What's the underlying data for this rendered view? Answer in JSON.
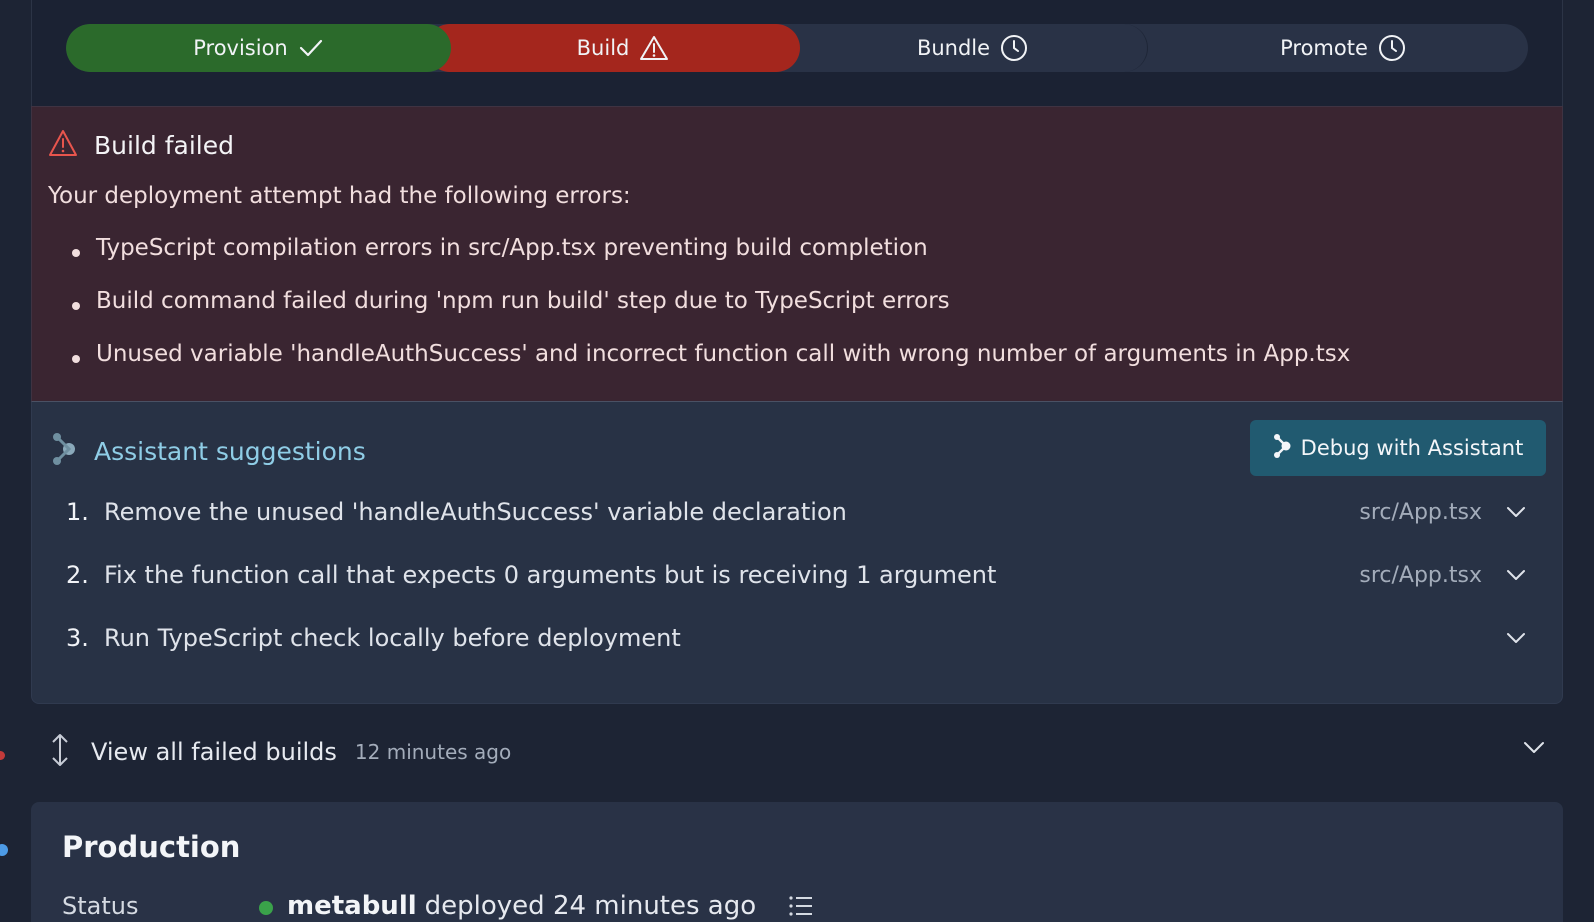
{
  "stepper": {
    "steps": [
      {
        "label": "Provision",
        "status": "success",
        "icon": "check-icon",
        "color": "#2b6a2b"
      },
      {
        "label": "Build",
        "status": "failed",
        "icon": "warning-icon",
        "color": "#a4261d"
      },
      {
        "label": "Bundle",
        "status": "pending",
        "icon": "clock-icon"
      },
      {
        "label": "Promote",
        "status": "pending",
        "icon": "clock-icon"
      }
    ]
  },
  "error": {
    "title": "Build failed",
    "intro": "Your deployment attempt had the following errors:",
    "items": [
      "TypeScript compilation errors in src/App.tsx preventing build completion",
      "Build command failed during 'npm run build' step due to TypeScript errors",
      "Unused variable 'handleAuthSuccess' and incorrect function call with wrong number of arguments in App.tsx"
    ]
  },
  "assistant": {
    "title": "Assistant suggestions",
    "debug_label": "Debug with Assistant",
    "suggestions": [
      {
        "num": "1.",
        "text": "Remove the unused 'handleAuthSuccess' variable declaration",
        "file": "src/App.tsx"
      },
      {
        "num": "2.",
        "text": "Fix the function call that expects 0 arguments but is receiving 1 argument",
        "file": "src/App.tsx"
      },
      {
        "num": "3.",
        "text": "Run TypeScript check locally before deployment",
        "file": ""
      }
    ]
  },
  "failed_builds": {
    "label": "View all failed builds",
    "time": "12 minutes ago"
  },
  "production": {
    "title": "Production",
    "status_label": "Status",
    "user": "metabull",
    "status_text": "deployed 24 minutes ago",
    "status_color": "#3aa24a"
  }
}
